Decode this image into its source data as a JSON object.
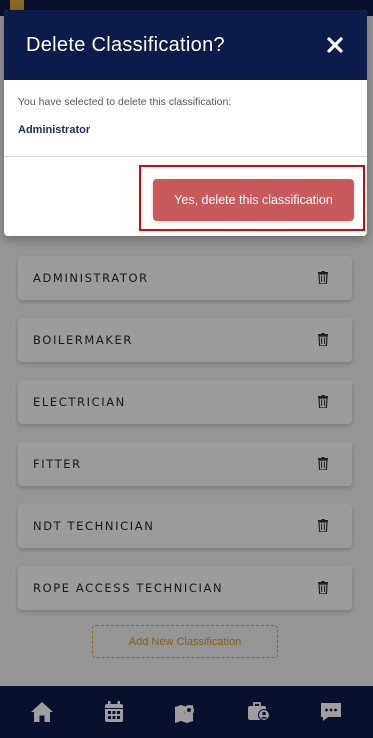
{
  "modal": {
    "title": "Delete Classification?",
    "message": "You have selected to delete this classification:",
    "selected_name": "Administrator",
    "confirm_label": "Yes, delete this classification"
  },
  "classifications": [
    {
      "label": "ADMINISTRATOR"
    },
    {
      "label": "BOILERMAKER"
    },
    {
      "label": "ELECTRICIAN"
    },
    {
      "label": "FITTER"
    },
    {
      "label": "NDT TECHNICIAN"
    },
    {
      "label": "ROPE ACCESS TECHNICIAN"
    }
  ],
  "add_button_label": "Add New Classification",
  "bottom_nav": [
    {
      "icon": "home-icon"
    },
    {
      "icon": "calendar-icon"
    },
    {
      "icon": "map-pin-icon"
    },
    {
      "icon": "briefcase-user-icon"
    },
    {
      "icon": "chat-icon"
    }
  ],
  "colors": {
    "navy": "#0d1b4a",
    "danger": "#c9595a",
    "accent": "#e5a823",
    "highlight": "#e00000"
  }
}
